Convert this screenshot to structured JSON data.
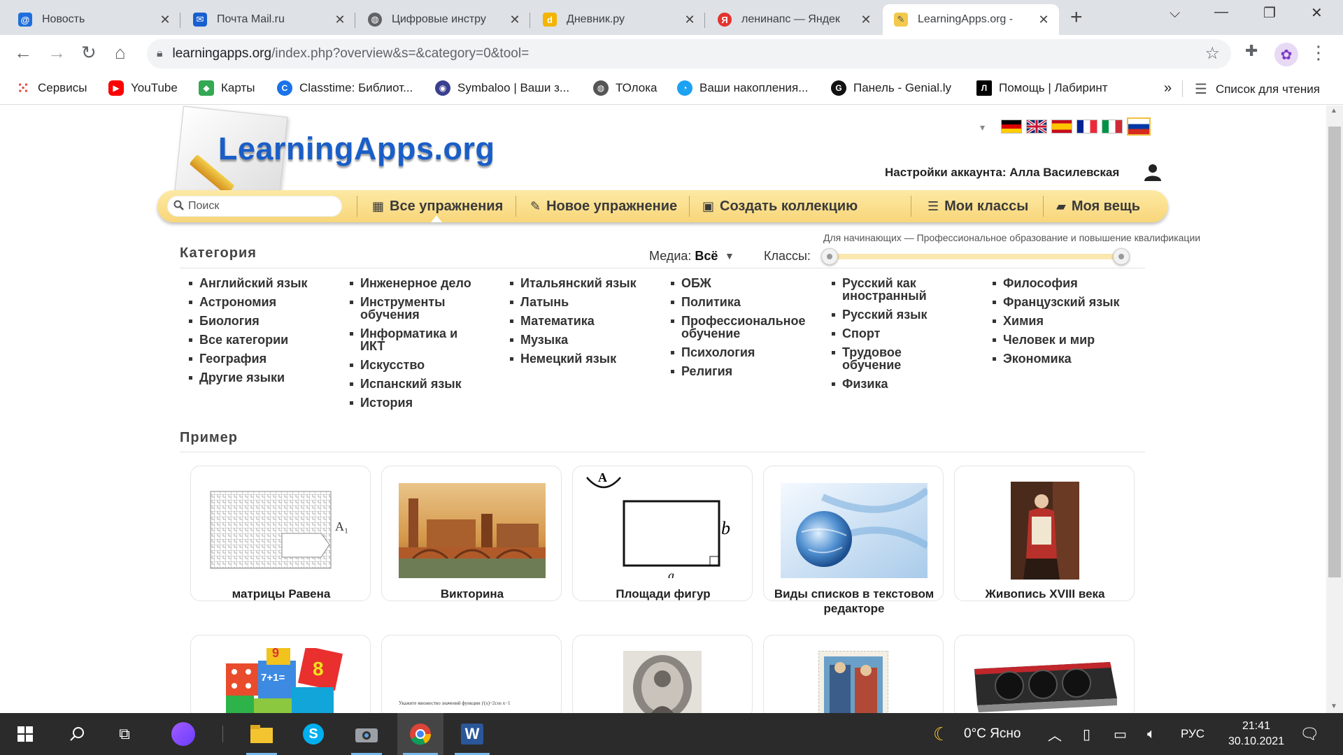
{
  "browser": {
    "tabs": [
      {
        "title": "Новость",
        "icon": "mail-ru-at-icon",
        "color": "#1e6fdc",
        "glyph": "@"
      },
      {
        "title": "Почта Mail.ru",
        "icon": "mail-envelope-icon",
        "color": "#1a5fd0",
        "glyph": "✉"
      },
      {
        "title": "Цифровые инстру",
        "icon": "globe-icon",
        "color": "#5f6368",
        "glyph": "◍"
      },
      {
        "title": "Дневник.ру",
        "icon": "dnevnik-icon",
        "color": "#f4b400",
        "glyph": "d"
      },
      {
        "title": "ленинапс — Яндек",
        "icon": "yandex-icon",
        "color": "#e3342f",
        "glyph": "Я"
      },
      {
        "title": "LearningApps.org -",
        "icon": "learningapps-icon",
        "color": "#f2c94c",
        "glyph": "✎"
      }
    ],
    "new_tab": "+",
    "url_host": "learningapps.org",
    "url_path": "/index.php?overview&s=&category=0&tool=",
    "bookmarks": [
      {
        "label": "Сервисы",
        "icon": "apps-grid-icon",
        "color": "#e94235"
      },
      {
        "label": "YouTube",
        "icon": "youtube-icon",
        "color": "#ff0000"
      },
      {
        "label": "Карты",
        "icon": "maps-icon",
        "color": "#34a853"
      },
      {
        "label": "Classtime: Библиот...",
        "icon": "classtime-icon",
        "color": "#1a73e8"
      },
      {
        "label": "Symbaloo | Ваши з...",
        "icon": "symbaloo-icon",
        "color": "#3b3f8f"
      },
      {
        "label": "ТОлока",
        "icon": "toloka-icon",
        "color": "#555555"
      },
      {
        "label": "Ваши накопления...",
        "icon": "savings-icon",
        "color": "#1da1f2"
      },
      {
        "label": "Панель - Genial.ly",
        "icon": "genially-icon",
        "color": "#111111"
      },
      {
        "label": "Помощь | Лабиринт",
        "icon": "labirint-icon",
        "color": "#000000"
      }
    ],
    "bookmarks_overflow": "»",
    "reading_list": "Список для чтения"
  },
  "site": {
    "logo": "LearningApps.org",
    "account_label": "Настройки аккаунта: Алла Василевская",
    "search_placeholder": "Поиск",
    "nav": {
      "all_exercises": "Все упражнения",
      "new_exercise": "Новое упражнение",
      "create_collection": "Создать коллекцию",
      "my_classes": "Мои классы",
      "my_stuff": "Моя вещь"
    },
    "category_heading": "Категория",
    "media_label": "Медиа:",
    "media_value": "Всё",
    "grades_label": "Классы:",
    "grades_range": "Для начинающих — Профессиональное образование и повышение квалификации",
    "categories": [
      [
        "Английский язык",
        "Астрономия",
        "Биология",
        "Все категории",
        "География",
        "Другие языки"
      ],
      [
        "Инженерное дело",
        "Инструменты обучения",
        "Информатика и ИКТ",
        "Искусство",
        "Испанский язык",
        "История"
      ],
      [
        "Итальянский язык",
        "Латынь",
        "Математика",
        "Музыка",
        "Немецкий язык"
      ],
      [
        "ОБЖ",
        "Политика",
        "Профессиональное обучение",
        "Психология",
        "Религия"
      ],
      [
        "Русский как иностранный",
        "Русский язык",
        "Спорт",
        "Трудовое обучение",
        "Физика"
      ],
      [
        "Философия",
        "Французский язык",
        "Химия",
        "Человек и мир",
        "Экономика"
      ]
    ],
    "example_heading": "Пример",
    "cards": [
      {
        "title": "матрицы Равена",
        "thumb": "raven-matrix"
      },
      {
        "title": "Викторина",
        "thumb": "verona-painting"
      },
      {
        "title": "Площади фигур",
        "thumb": "rectangle-figure"
      },
      {
        "title": "Виды списков в текстовом редакторе",
        "thumb": "globe-abstract"
      },
      {
        "title": "Живопись XVIII века",
        "thumb": "portrait-painting"
      }
    ],
    "matrix_label": "A₁",
    "figure_labels": {
      "top": "A",
      "side": "b",
      "bottom": "a"
    },
    "function_text": "Укажите множество значений функции   ƒ(x)=2cos x−1",
    "dice_labels": [
      "7+1=",
      "8",
      "9"
    ]
  },
  "taskbar": {
    "weather": "0°C  Ясно",
    "language": "РУС",
    "time": "21:41",
    "date": "30.10.2021"
  }
}
